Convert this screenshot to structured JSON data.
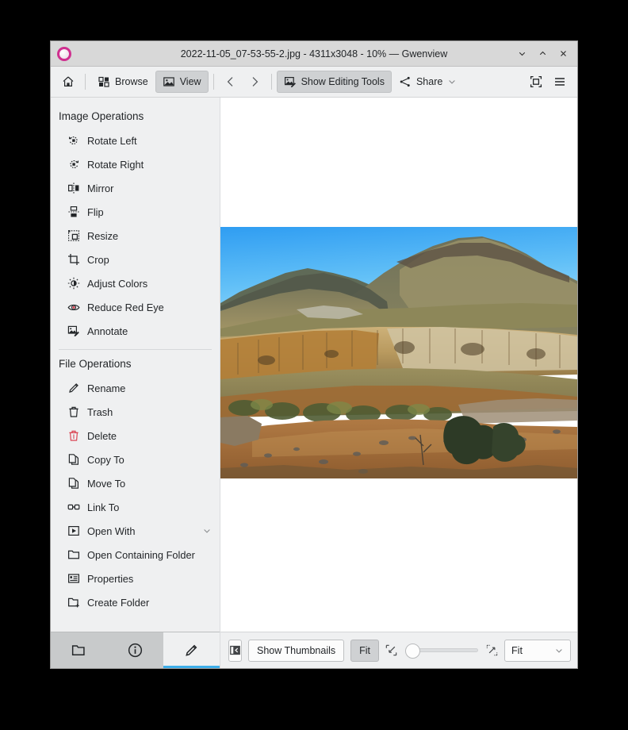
{
  "window": {
    "title": "2022-11-05_07-53-55-2.jpg - 4311x3048 - 10% — Gwenview",
    "app_icon": "gwenview-icon",
    "controls": [
      {
        "name": "minimize-button",
        "glyph": "minimize-icon"
      },
      {
        "name": "maximize-button",
        "glyph": "maximize-icon"
      },
      {
        "name": "close-button",
        "glyph": "close-icon"
      }
    ]
  },
  "toolbar": {
    "home_label": "",
    "home_icon": "home-icon",
    "browse_label": "Browse",
    "browse_icon": "grid-icon",
    "view_label": "View",
    "view_icon": "image-icon",
    "previous_icon": "chevron-left-icon",
    "next_icon": "chevron-right-icon",
    "editing_tools_label": "Show Editing Tools",
    "editing_tools_icon": "image-edit-icon",
    "share_label": "Share",
    "share_icon": "share-dots-icon",
    "share_chevron": "chevron-down-icon",
    "fullscreen_icon": "fullscreen-icon",
    "menu_icon": "hamburger-menu-icon"
  },
  "sidebar": {
    "image_operations": {
      "title": "Image Operations",
      "items": [
        {
          "label": "Rotate Left",
          "icon": "rotate-left-icon",
          "name": "sidebar-item-rotate-left"
        },
        {
          "label": "Rotate Right",
          "icon": "rotate-right-icon",
          "name": "sidebar-item-rotate-right"
        },
        {
          "label": "Mirror",
          "icon": "mirror-icon",
          "name": "sidebar-item-mirror"
        },
        {
          "label": "Flip",
          "icon": "flip-icon",
          "name": "sidebar-item-flip"
        },
        {
          "label": "Resize",
          "icon": "resize-icon",
          "name": "sidebar-item-resize"
        },
        {
          "label": "Crop",
          "icon": "crop-icon",
          "name": "sidebar-item-crop"
        },
        {
          "label": "Adjust Colors",
          "icon": "brightness-icon",
          "name": "sidebar-item-adjust-colors"
        },
        {
          "label": "Reduce Red Eye",
          "icon": "red-eye-icon",
          "name": "sidebar-item-reduce-red-eye"
        },
        {
          "label": "Annotate",
          "icon": "annotate-icon",
          "name": "sidebar-item-annotate"
        }
      ]
    },
    "file_operations": {
      "title": "File Operations",
      "items": [
        {
          "label": "Rename",
          "icon": "pencil-icon",
          "name": "sidebar-item-rename"
        },
        {
          "label": "Trash",
          "icon": "trash-icon",
          "name": "sidebar-item-trash"
        },
        {
          "label": "Delete",
          "icon": "delete-icon",
          "name": "sidebar-item-delete",
          "danger": true
        },
        {
          "label": "Copy To",
          "icon": "copy-icon",
          "name": "sidebar-item-copy-to"
        },
        {
          "label": "Move To",
          "icon": "copy-icon",
          "name": "sidebar-item-move-to"
        },
        {
          "label": "Link To",
          "icon": "link-icon",
          "name": "sidebar-item-link-to"
        },
        {
          "label": "Open With",
          "icon": "open-with-icon",
          "name": "sidebar-item-open-with",
          "chevron": "chevron-down-icon"
        },
        {
          "label": "Open Containing Folder",
          "icon": "folder-icon",
          "name": "sidebar-item-open-containing-folder"
        },
        {
          "label": "Properties",
          "icon": "properties-icon",
          "name": "sidebar-item-properties"
        },
        {
          "label": "Create Folder",
          "icon": "folder-new-icon",
          "name": "sidebar-item-create-folder"
        }
      ]
    },
    "tabs": [
      {
        "name": "side-tab-folder",
        "icon": "folder-icon",
        "selected": false
      },
      {
        "name": "side-tab-info",
        "icon": "info-icon",
        "selected": false
      },
      {
        "name": "side-tab-operations",
        "icon": "pencil-icon",
        "selected": true
      }
    ]
  },
  "statusbar": {
    "sidebar_toggle_icon": "panel-collapse-icon",
    "thumbnails_label": "Show Thumbnails",
    "fit_button_label": "Fit",
    "zoom_out_icon": "zoom-out-icon",
    "zoom_in_icon": "zoom-in-icon",
    "zoom_value": "Fit",
    "zoom_chevron": "chevron-down-icon",
    "zoom_slider_percent": 0
  },
  "colors": {
    "accent": "#3daee9",
    "window_bg": "#eff0f1",
    "danger": "#da4453",
    "titlebar": "#d8d8d8",
    "desktop": "#000000"
  },
  "photo": {
    "alt": "desert canyon landscape with rocky cliffs and muddy river",
    "sky_top": "#3aa8f5",
    "sky_bottom": "#8fd4f7",
    "ridge": "#6a6a5c",
    "cliff": "#c9a86b",
    "river": "#9a6a3a"
  }
}
